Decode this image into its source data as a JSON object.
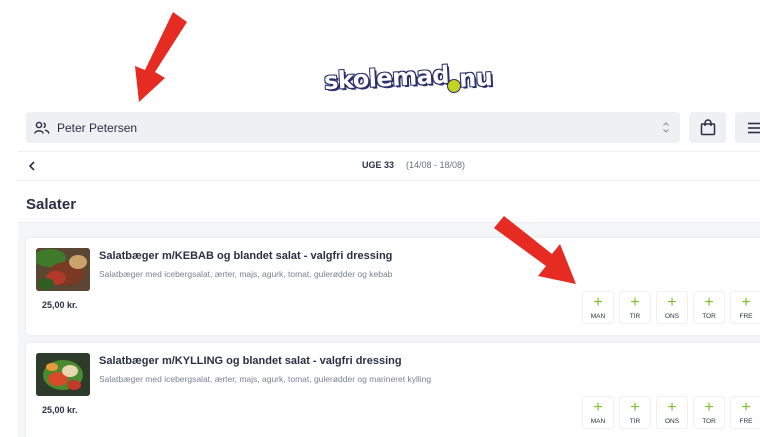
{
  "brand": {
    "logo_text_a": "skolemad",
    "logo_text_b": "nu"
  },
  "user": {
    "name": "Peter Petersen"
  },
  "week": {
    "label": "UGE 33",
    "range": "(14/08 - 18/08)"
  },
  "category": {
    "title": "Salater"
  },
  "products": [
    {
      "title": "Salatbæger m/KEBAB og blandet salat - valgfri dressing",
      "description": "Salatbæger med icebergsalat, ærter, majs, agurk, tomat, gulerødder og kebab",
      "price": "25,00 kr."
    },
    {
      "title": "Salatbæger m/KYLLING og blandet salat - valgfri dressing",
      "description": "Salatbæger med icebergsalat, ærter, majs, agurk, tomat, gulerødder og marineret kylling",
      "price": "25,00 kr."
    }
  ],
  "days": [
    "MAN",
    "TIR",
    "ONS",
    "TOR",
    "FRE"
  ],
  "add_symbol": "+",
  "colors": {
    "accent_green": "#7cbf2a",
    "text_dark": "#2a2f45",
    "bar_bg": "#eef0f3",
    "annotation_red": "#e52b22"
  }
}
